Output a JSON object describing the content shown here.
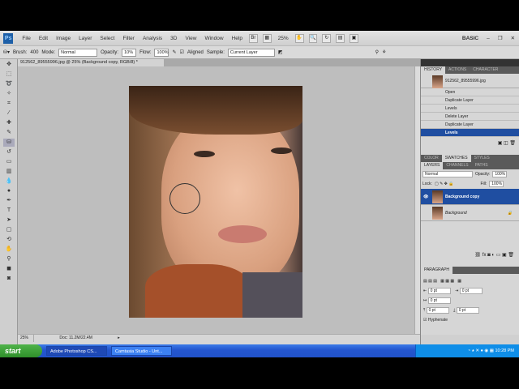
{
  "menubar": {
    "items": [
      "File",
      "Edit",
      "Image",
      "Layer",
      "Select",
      "Filter",
      "Analysis",
      "3D",
      "View",
      "Window",
      "Help"
    ],
    "zoom": "25%",
    "workspace": "BASIC"
  },
  "options": {
    "brush_label": "Brush:",
    "brush_size": "400",
    "mode_label": "Mode:",
    "mode": "Normal",
    "opacity_label": "Opacity:",
    "opacity": "10%",
    "flow_label": "Flow:",
    "flow": "100%",
    "aligned_label": "Aligned",
    "sample_label": "Sample:",
    "sample": "Current Layer"
  },
  "document": {
    "tab_title": "912562_89555996.jpg @ 25% (Background copy, RGB/8) *",
    "zoom": "25%",
    "doc_info": "Doc: 11.2M/22.4M"
  },
  "history": {
    "tabs": [
      "HISTORY",
      "ACTIONS",
      "CHARACTER"
    ],
    "snapshot": "912562_89555996.jpg",
    "items": [
      "Open",
      "Duplicate Layer",
      "Levels",
      "Delete Layer",
      "Duplicate Layer",
      "Levels"
    ]
  },
  "color_tabs": [
    "COLOR",
    "SWATCHES",
    "STYLES"
  ],
  "layers": {
    "tabs": [
      "LAYERS",
      "CHANNELS",
      "PATHS"
    ],
    "blend": "Normal",
    "opacity_label": "Opacity:",
    "opacity": "100%",
    "lock_label": "Lock:",
    "fill_label": "Fill:",
    "fill": "100%",
    "items": [
      "Background copy",
      "Background"
    ]
  },
  "paragraph": {
    "title": "PARAGRAPH",
    "values": [
      "0 pt",
      "0 pt",
      "0 pt",
      "0 pt",
      "0 pt"
    ],
    "hyphenate": "Hyphenate"
  },
  "taskbar": {
    "start": "start",
    "tasks": [
      "Adobe Photoshop CS...",
      "Camtasia Studio - Unt..."
    ],
    "clock": "10:28 PM"
  }
}
